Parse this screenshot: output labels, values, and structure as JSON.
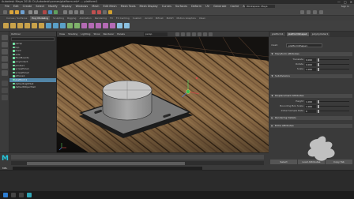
{
  "window": {
    "title": "Autodesk Maya 2018: D:\\Autodesk\\scenes\\platform.mb* --- platform1",
    "controls": [
      "—",
      "□",
      "✕"
    ]
  },
  "menubar": {
    "items": [
      "File",
      "Edit",
      "Create",
      "Select",
      "Modify",
      "Display",
      "Windows",
      "Mesh",
      "Edit Mesh",
      "Mesh Tools",
      "Mesh Display",
      "Curves",
      "Surfaces",
      "Deform",
      "UV",
      "Generate",
      "Cache",
      "Arnold",
      "Help"
    ],
    "workspace": "Workspace: Maya Classic",
    "sign_in": "Sign In"
  },
  "shelf": {
    "tabs": [
      "Curves / Surfaces",
      "Poly Modeling",
      "Sculpting",
      "Rigging",
      "Animation",
      "Rendering",
      "FX",
      "FX Caching",
      "Custom",
      "Arnold",
      "Bifrost",
      "MASH",
      "Motion Graphics",
      "XGen"
    ],
    "active_tab": "Poly Modeling"
  },
  "outliner": {
    "title": "Outliner",
    "items": [
      {
        "label": "persp",
        "selected": false
      },
      {
        "label": "top",
        "selected": false
      },
      {
        "label": "front",
        "selected": false
      },
      {
        "label": "side",
        "selected": false
      },
      {
        "label": "floorBoards",
        "selected": false
      },
      {
        "label": "pCylinder1",
        "selected": false
      },
      {
        "label": "pCube1",
        "selected": false
      },
      {
        "label": "screwHole1",
        "selected": false
      },
      {
        "label": "screwHole2",
        "selected": false
      },
      {
        "label": "pPlane1",
        "selected": false
      },
      {
        "label": "platform1",
        "selected": true
      },
      {
        "label": "defaultLightSet",
        "selected": false
      },
      {
        "label": "defaultObjectSet",
        "selected": false
      }
    ]
  },
  "viewport": {
    "menu": [
      "View",
      "Shading",
      "Lighting",
      "Show",
      "Renderer",
      "Panels"
    ],
    "camera_field": "persp"
  },
  "attribute_editor": {
    "tabs": [
      "platform1",
      "platformShape1",
      "polyCylinder1"
    ],
    "active_tab": "platformShape1",
    "name_label": "mesh:",
    "name_value": "platformShape1",
    "sections": [
      {
        "label": "Transform Attributes",
        "open": true
      },
      {
        "label": "Subdivisions",
        "open": true
      },
      {
        "label": "Displacement Attributes",
        "open": true
      },
      {
        "label": "Rendering Details",
        "open": false
      },
      {
        "label": "Extra Attributes",
        "open": false
      }
    ],
    "fields": [
      {
        "label": "Translate",
        "value": "0.000"
      },
      {
        "label": "Rotate",
        "value": "0.000"
      },
      {
        "label": "Scale",
        "value": "1.000"
      },
      {
        "label": "Height",
        "value": "1.000"
      },
      {
        "label": "Bounding Box Scale",
        "value": "1.000"
      },
      {
        "label": "Initial Sample Rate",
        "value": "6"
      }
    ],
    "buttons": [
      "Select",
      "Load Attributes",
      "Copy Tab"
    ]
  },
  "commandline": {
    "label": "MEL"
  },
  "colors": {
    "accent_select": "#5285a6",
    "wood_light": "#8a6a45",
    "wood_dark": "#4e3722",
    "maya_logo": "#26c6da"
  }
}
